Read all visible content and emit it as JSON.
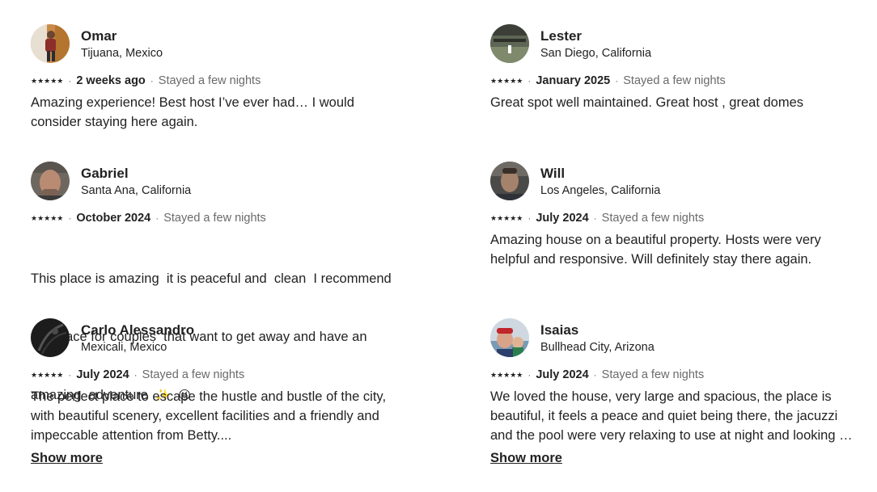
{
  "reviews": [
    {
      "name": "Omar",
      "location": "Tijuana, Mexico",
      "stars": "★★★★★",
      "when": "2 weeks ago",
      "stay": "Stayed a few nights",
      "lines": [
        "Amazing experience! Best host I’ve ever had… I would",
        "consider staying here again."
      ]
    },
    {
      "name": "Lester",
      "location": "San Diego, California",
      "stars": "★★★★★",
      "when": "January 2025",
      "stay": "Stayed a few nights",
      "lines": [
        "Great spot well maintained. Great host , great domes"
      ]
    },
    {
      "name": "Gabriel",
      "location": "Santa Ana, California",
      "stars": "★★★★★",
      "when": "October 2024",
      "stay": "Stayed a few nights",
      "lines": [
        "This place is amazing  it is peaceful and  clean  I recommend",
        "this place for couples  that want to get away and have an",
        "amazing  adventure"
      ],
      "emoji": "✨  😜"
    },
    {
      "name": "Will",
      "location": "Los Angeles, California",
      "stars": "★★★★★",
      "when": "July 2024",
      "stay": "Stayed a few nights",
      "lines": [
        "Amazing house on a beautiful property. Hosts were very",
        "helpful and responsive. Will definitely stay there again."
      ]
    },
    {
      "name": "Carlo Alessandro",
      "location": "Mexicali, Mexico",
      "stars": "★★★★★",
      "when": "July 2024",
      "stay": "Stayed a few nights",
      "lines": [
        "The perfect place to escape the hustle and bustle of the city,",
        "with beautiful scenery, excellent facilities and a friendly and",
        "impeccable attention from Betty...."
      ]
    },
    {
      "name": "Isaias",
      "location": "Bullhead City, Arizona",
      "stars": "★★★★★",
      "when": "July 2024",
      "stay": "Stayed a few nights",
      "lines": [
        "We loved the house, very large and spacious, the place is",
        "beautiful, it feels a peace and quiet being there, the jacuzzi",
        "and the pool were very relaxing to use at night and looking at the stars"
      ]
    }
  ],
  "show_more_label": "Show more",
  "separator": "·"
}
